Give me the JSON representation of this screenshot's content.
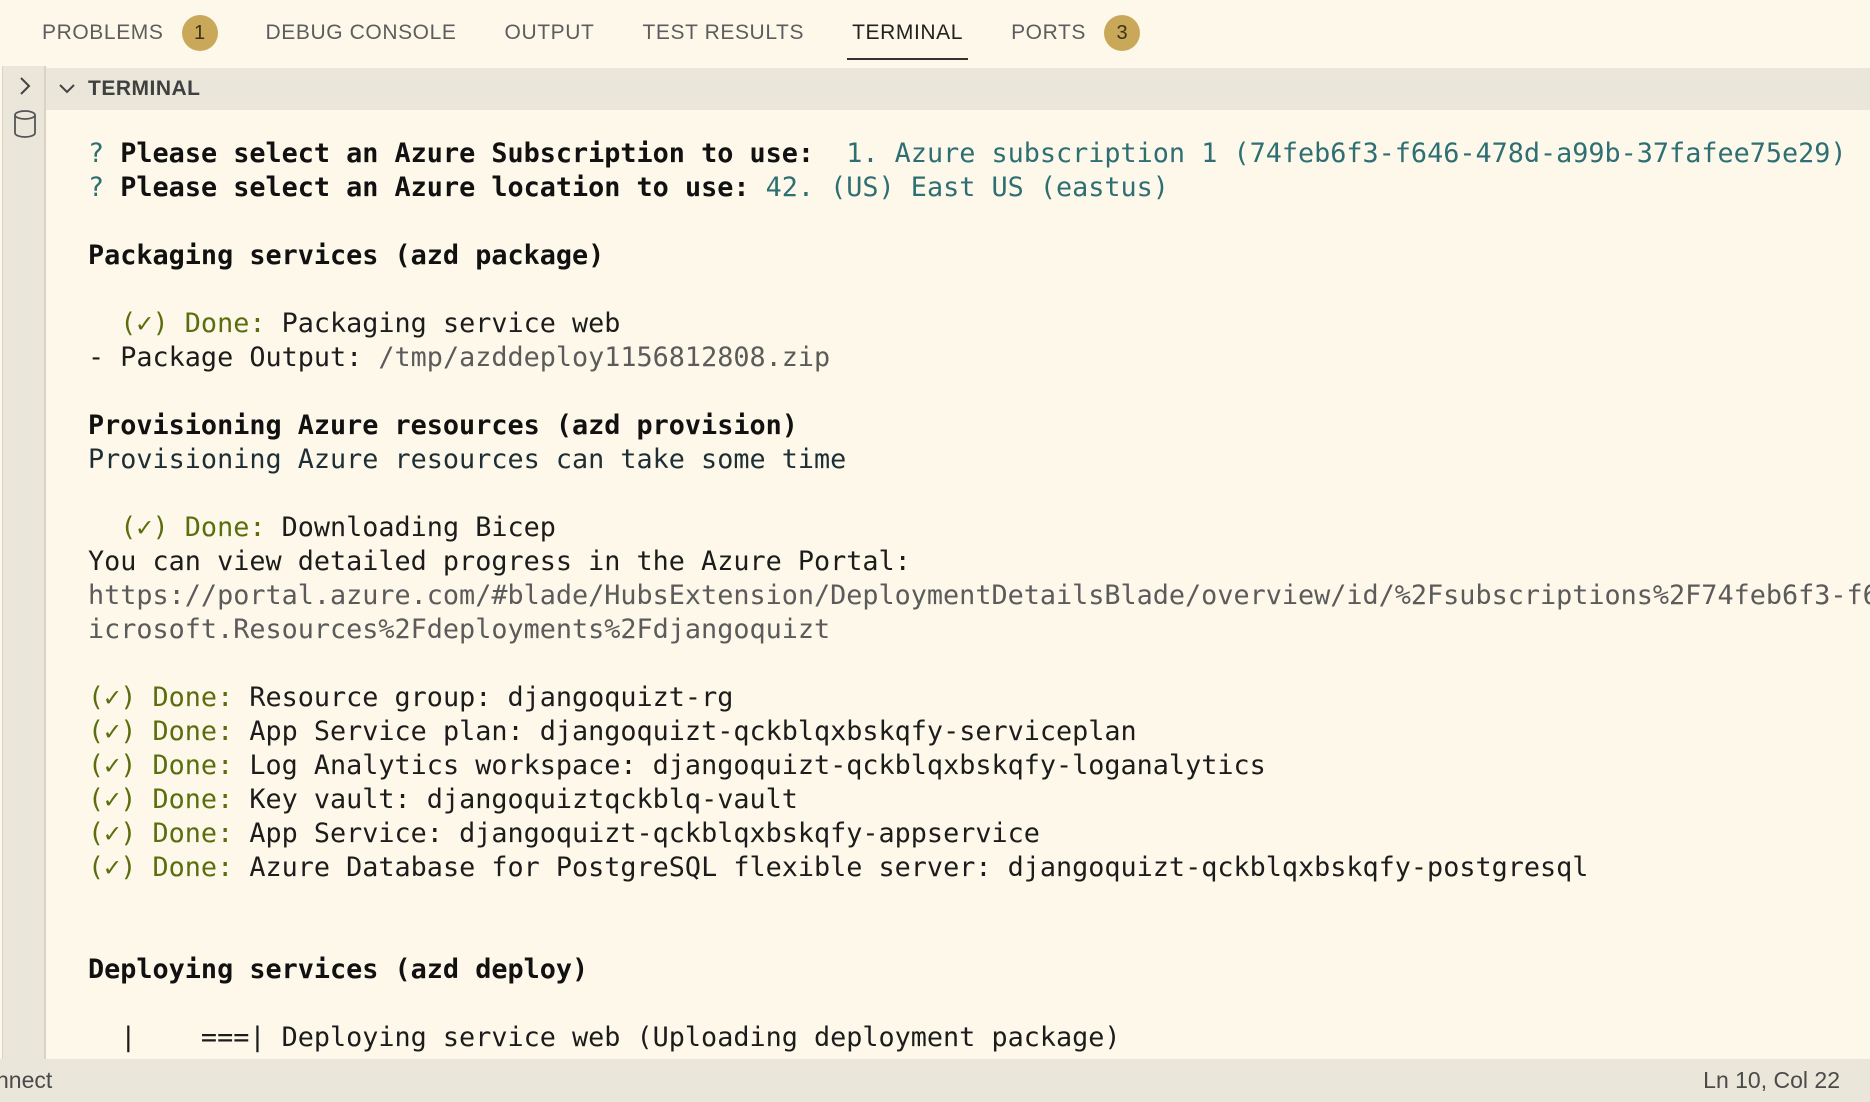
{
  "tabs": [
    {
      "label": "PROBLEMS",
      "badge": "1"
    },
    {
      "label": "DEBUG CONSOLE"
    },
    {
      "label": "OUTPUT"
    },
    {
      "label": "TEST RESULTS"
    },
    {
      "label": "TERMINAL",
      "active": true
    },
    {
      "label": "PORTS",
      "badge": "3"
    }
  ],
  "section": {
    "title": "TERMINAL"
  },
  "terminal": {
    "lines": [
      [
        {
          "t": "? ",
          "c": "teal"
        },
        {
          "t": "Please select an Azure Subscription to use: ",
          "c": "b"
        },
        {
          "t": " 1. Azure subscription 1 (74feb6f3-f646-478d-a99b-37fafee75e29)",
          "c": "teal"
        }
      ],
      [
        {
          "t": "? ",
          "c": "teal"
        },
        {
          "t": "Please select an Azure location to use: ",
          "c": "b"
        },
        {
          "t": "42. (US) East US (eastus)",
          "c": "teal"
        }
      ],
      [],
      [
        {
          "t": "Packaging services (azd package)",
          "c": "b"
        }
      ],
      [],
      [
        {
          "t": "  (✓) Done: ",
          "c": "green"
        },
        {
          "t": "Packaging service web"
        }
      ],
      [
        {
          "t": "- Package Output: "
        },
        {
          "t": "/tmp/azddeploy1156812808.zip",
          "c": "grey"
        }
      ],
      [],
      [
        {
          "t": "Provisioning Azure resources (azd provision)",
          "c": "b"
        }
      ],
      [
        {
          "t": "Provisioning Azure resources can take some time",
          "c": "dark"
        }
      ],
      [],
      [
        {
          "t": "  (✓) Done: ",
          "c": "green"
        },
        {
          "t": "Downloading Bicep"
        }
      ],
      [
        {
          "t": "You can view detailed progress in the Azure Portal:"
        }
      ],
      [
        {
          "t": "https://portal.azure.com/#blade/HubsExtension/DeploymentDetailsBlade/overview/id/%2Fsubscriptions%2F74feb6f3-f64",
          "c": "grey"
        }
      ],
      [
        {
          "t": "icrosoft.Resources%2Fdeployments%2Fdjangoquizt",
          "c": "grey"
        }
      ],
      [],
      [
        {
          "t": "(✓) Done: ",
          "c": "green"
        },
        {
          "t": "Resource group: djangoquizt-rg"
        }
      ],
      [
        {
          "t": "(✓) Done: ",
          "c": "green"
        },
        {
          "t": "App Service plan: djangoquizt-qckblqxbskqfy-serviceplan"
        }
      ],
      [
        {
          "t": "(✓) Done: ",
          "c": "green"
        },
        {
          "t": "Log Analytics workspace: djangoquizt-qckblqxbskqfy-loganalytics"
        }
      ],
      [
        {
          "t": "(✓) Done: ",
          "c": "green"
        },
        {
          "t": "Key vault: djangoquiztqckblq-vault"
        }
      ],
      [
        {
          "t": "(✓) Done: ",
          "c": "green"
        },
        {
          "t": "App Service: djangoquizt-qckblqxbskqfy-appservice"
        }
      ],
      [
        {
          "t": "(✓) Done: ",
          "c": "green"
        },
        {
          "t": "Azure Database for PostgreSQL flexible server: djangoquizt-qckblqxbskqfy-postgresql"
        }
      ],
      [],
      [],
      [
        {
          "t": "Deploying services (azd deploy)",
          "c": "b"
        }
      ],
      [],
      [
        {
          "t": "  |    ===| Deploying service web (Uploading deployment package)"
        }
      ]
    ]
  },
  "statusbar": {
    "left": "nnect",
    "right": "Ln 10, Col 22"
  },
  "icons": {
    "expand": "chevron-right-icon",
    "database": "database-icon",
    "collapse": "chevron-down-icon"
  }
}
